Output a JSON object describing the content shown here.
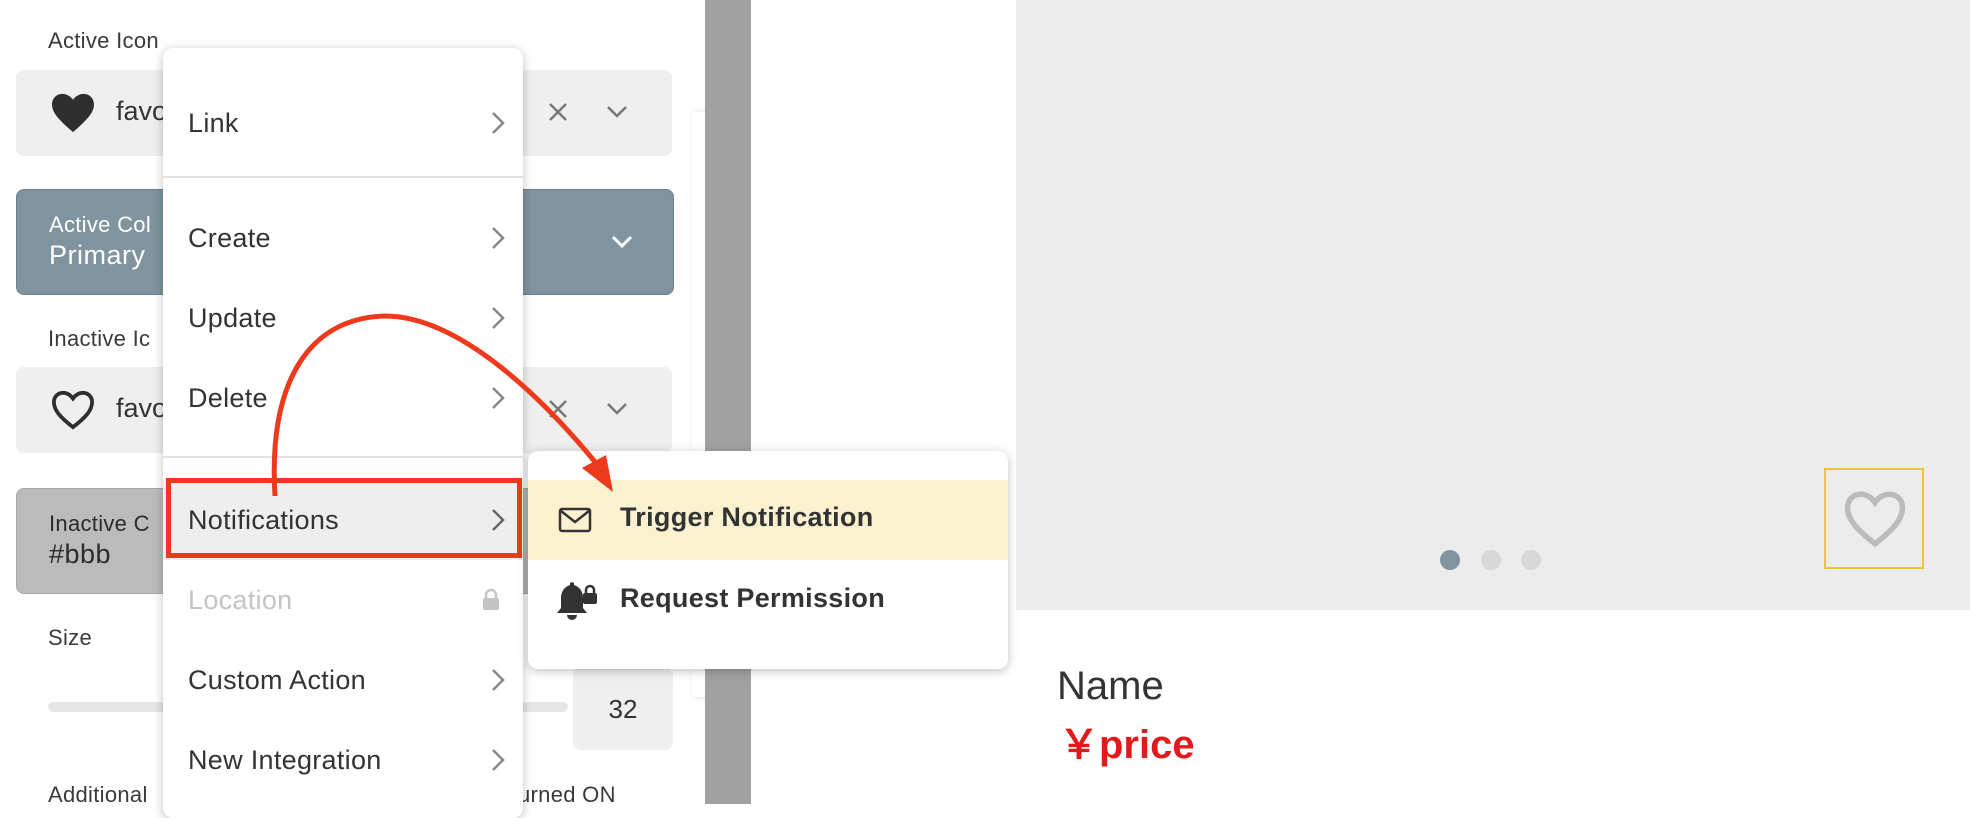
{
  "properties": {
    "active_icon_label": "Active Icon",
    "active_icon_value": "favo",
    "active_color_label": "Active Col",
    "active_color_value": "Primary",
    "inactive_icon_label": "Inactive Ic",
    "inactive_icon_value": "favo",
    "inactive_color_label": "Inactive C",
    "inactive_color_value": "#bbb",
    "size_label": "Size",
    "size_value": "32",
    "additional_label": "Additional",
    "turned_on_text": "urned ON"
  },
  "action_menu": {
    "items": [
      {
        "label": "Link"
      },
      {
        "label": "Create"
      },
      {
        "label": "Update"
      },
      {
        "label": "Delete"
      },
      {
        "label": "Notifications"
      },
      {
        "label": "Location"
      },
      {
        "label": "Custom Action"
      },
      {
        "label": "New Integration"
      }
    ]
  },
  "submenu": {
    "items": [
      {
        "label": "Trigger Notification",
        "icon": "mail-icon"
      },
      {
        "label": "Request Permission",
        "icon": "bell-lock-icon"
      }
    ]
  },
  "product": {
    "name": "Name",
    "price": "￥price"
  },
  "colors": {
    "primary": "#7f949e",
    "inactive": "#bbbbbb",
    "highlight": "#ee3a1c",
    "price": "#e11b1b",
    "selected_submenu_bg": "#fdf2d0",
    "favorite_outline": "#f0c23a"
  }
}
